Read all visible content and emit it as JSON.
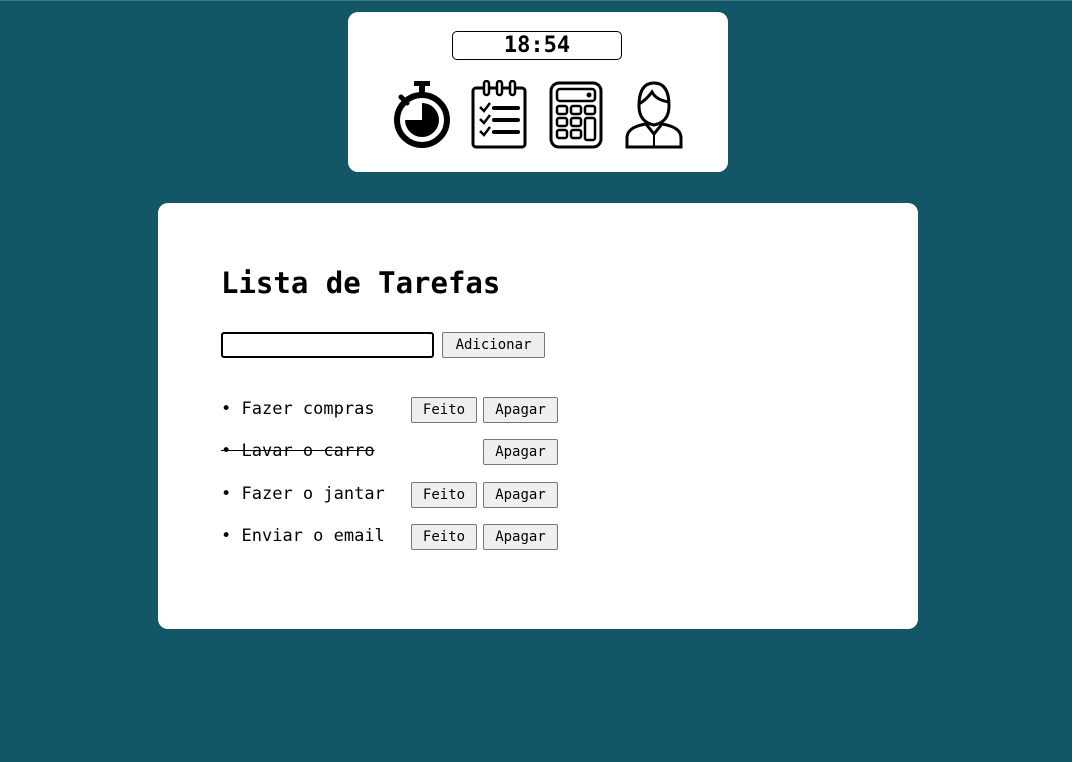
{
  "header": {
    "clock_time": "18:54",
    "apps": [
      {
        "icon": "stopwatch-icon"
      },
      {
        "icon": "checklist-icon"
      },
      {
        "icon": "calculator-icon"
      },
      {
        "icon": "user-profile-icon"
      }
    ]
  },
  "todo": {
    "title": "Lista de Tarefas",
    "input_value": "",
    "add_label": "Adicionar",
    "done_label": "Feito",
    "delete_label": "Apagar",
    "bullet": "•",
    "tasks": [
      {
        "text": "Fazer compras",
        "completed": false
      },
      {
        "text": "Lavar o carro",
        "completed": true
      },
      {
        "text": "Fazer o jantar",
        "completed": false
      },
      {
        "text": "Enviar o email",
        "completed": false
      }
    ]
  },
  "colors": {
    "background": "#125667",
    "card": "#ffffff"
  }
}
